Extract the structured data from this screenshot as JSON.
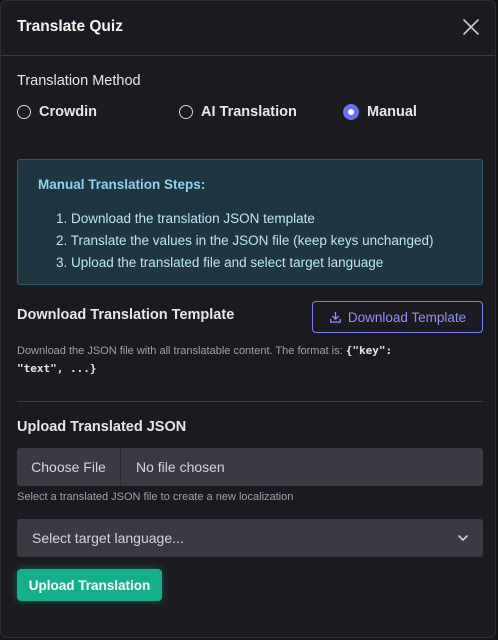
{
  "modal": {
    "title": "Translate Quiz",
    "close_icon": "close-icon"
  },
  "method": {
    "label": "Translation Method",
    "options": [
      {
        "label": "Crowdin",
        "selected": false
      },
      {
        "label": "AI Translation",
        "selected": false
      },
      {
        "label": "Manual",
        "selected": true
      }
    ]
  },
  "steps": {
    "title": "Manual Translation Steps:",
    "items": [
      "1. Download the translation JSON template",
      "2. Translate the values in the JSON file (keep keys unchanged)",
      "3. Upload the translated file and select target language"
    ]
  },
  "download": {
    "label": "Download Translation Template",
    "button_label": "Download Template",
    "button_icon": "download-icon",
    "help_prefix": "Download the JSON file with all translatable content. The format is: ",
    "help_code_1": "{\"key\":",
    "help_code_2": "\"text\", ...}"
  },
  "upload": {
    "label": "Upload Translated JSON",
    "choose_file_label": "Choose File",
    "no_file_text": "No file chosen",
    "help": "Select a translated JSON file to create a new localization",
    "select_placeholder": "Select target language...",
    "select_icon": "chevron-down-icon",
    "button_label": "Upload Translation"
  },
  "colors": {
    "background": "#1b1b1f",
    "accent": "#6d6df0",
    "info_bg": "#1f3640",
    "info_text": "#8fd3f0",
    "success": "#14b08c"
  }
}
